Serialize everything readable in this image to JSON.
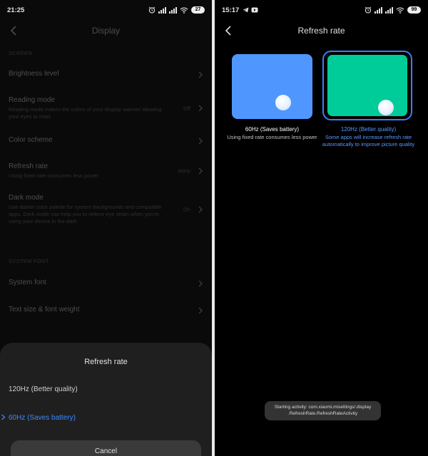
{
  "left": {
    "status": {
      "time": "21:25",
      "battery": "27"
    },
    "header_title": "Display",
    "sections": {
      "screen": "SCREEN",
      "system_font": "SYSTEM FONT"
    },
    "items": {
      "brightness": {
        "label": "Brightness level"
      },
      "reading": {
        "label": "Reading mode",
        "desc": "Reading mode makes the colors of your display warmer allowing your eyes to relax",
        "value": "Off"
      },
      "color": {
        "label": "Color scheme"
      },
      "refresh": {
        "label": "Refresh rate",
        "desc": "Using fixed rate consumes less power",
        "value": "60Hz"
      },
      "dark": {
        "label": "Dark mode",
        "desc": "Use darker color palette for system backgrounds and compatible apps. Dark mode can help you to relieve eye strain when you're using your device in the dark",
        "value": "On"
      },
      "sysfont": {
        "label": "System font"
      },
      "textsize": {
        "label": "Text size & font weight"
      }
    },
    "dialog": {
      "title": "Refresh rate",
      "options": [
        "120Hz (Better quality)",
        "60Hz (Saves battery)"
      ],
      "selected": "60Hz (Saves battery)",
      "cancel": "Cancel"
    }
  },
  "right": {
    "status": {
      "time": "15:17",
      "battery": "99"
    },
    "header_title": "Refresh rate",
    "option60": {
      "title": "60Hz (Saves battery)",
      "desc": "Using fixed rate consumes less power"
    },
    "option120": {
      "title": "120Hz (Better quality)",
      "desc_line1": "Some apps will increase refresh rate",
      "desc_line2": "automatically to improve picture quality"
    },
    "toast": {
      "line1": "Starting activity: com.xiaomi.misettings/.display",
      "line2": ".RefreshRate.RefreshRateActivity"
    }
  },
  "colors": {
    "accent": "#3d89ff",
    "card60": "#4f97ff",
    "card120": "#00cc99",
    "background": "#000000"
  },
  "icons": [
    "back-arrow-icon",
    "chevron-right-icon",
    "alarm-icon",
    "wifi-icon",
    "signal-icon",
    "battery-icon",
    "telegram-icon",
    "youtube-icon"
  ]
}
